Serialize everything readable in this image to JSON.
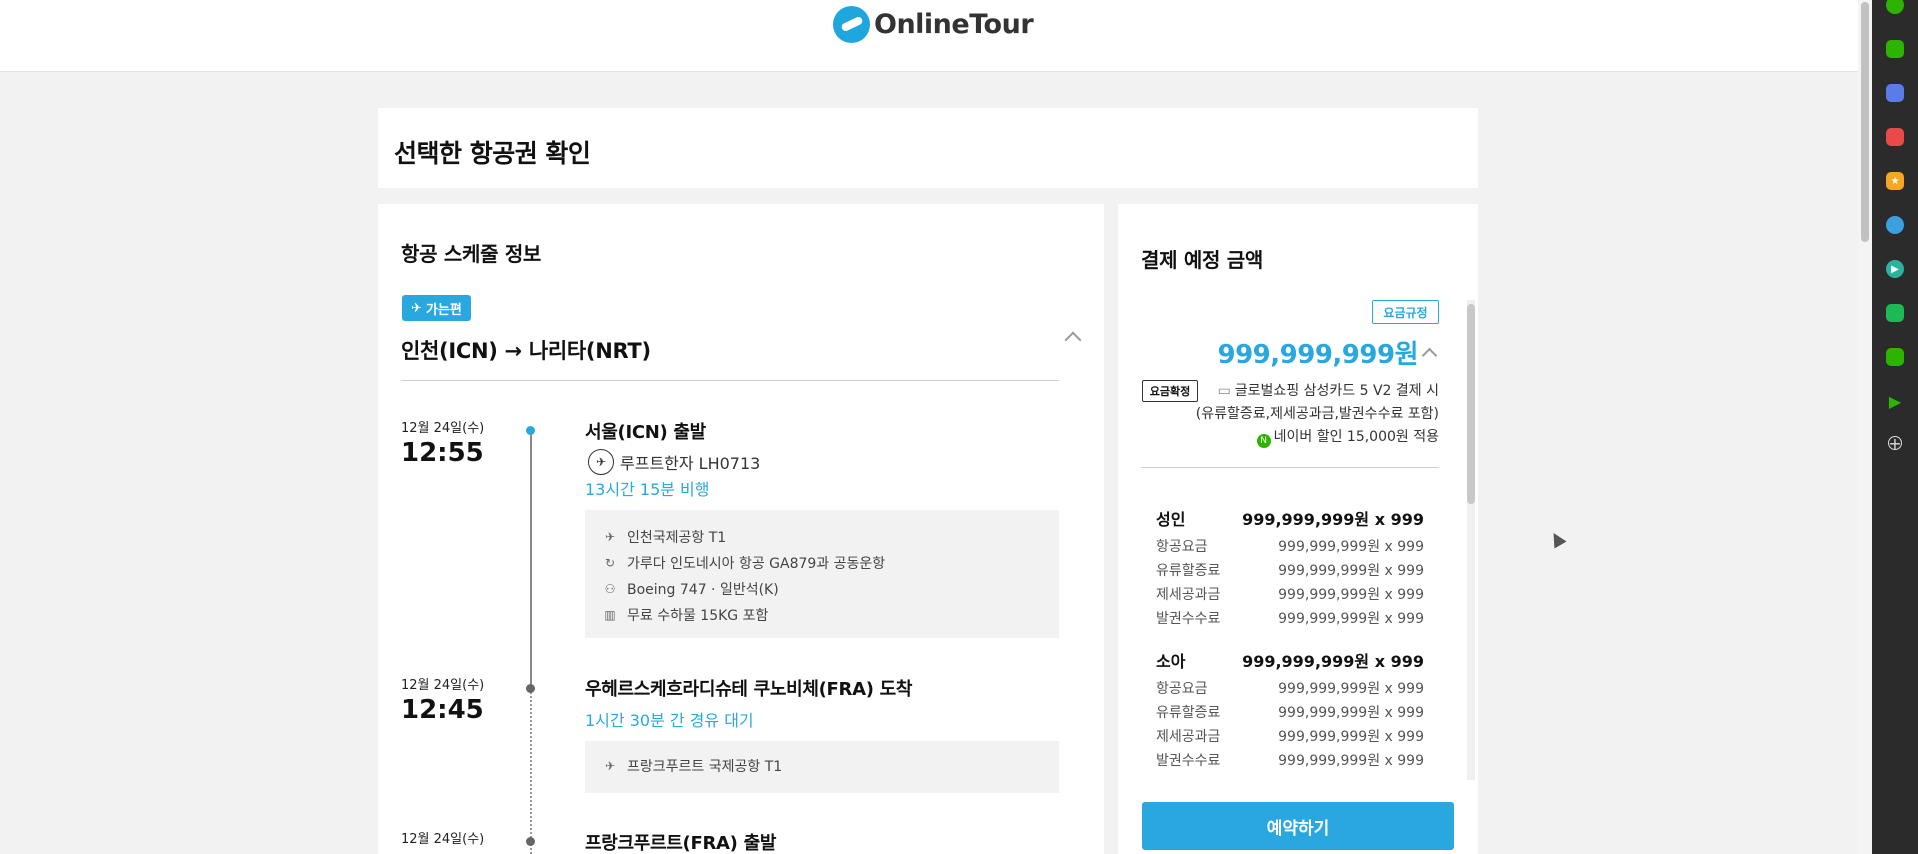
{
  "header": {
    "logo_text": "OnlineTour"
  },
  "page": {
    "title": "선택한 항공권 확인"
  },
  "schedule": {
    "title": "항공 스케줄 정보",
    "direction_badge": "가는편",
    "route": "인천(ICN) → 나리타(NRT)",
    "segments": [
      {
        "date": "12월 24일(수)",
        "time": "12:55",
        "title": "서울(ICN) 출발",
        "airline": "루프트한자 LH0713",
        "accent": "13시간 15분 비행",
        "details": [
          {
            "icon": "airport-icon",
            "text": "인천국제공항 T1"
          },
          {
            "icon": "codeshare-icon",
            "text": "가루다 인도네시아 항공 GA879과 공동운항"
          },
          {
            "icon": "seat-icon",
            "text": "Boeing 747 · 일반석(K)"
          },
          {
            "icon": "baggage-icon",
            "text": "무료 수하물 15KG 포함"
          }
        ]
      },
      {
        "date": "12월 24일(수)",
        "time": "12:45",
        "title": "우헤르스케흐라디슈테 쿠노비체(FRA) 도착",
        "accent": "1시간 30분 간 경유 대기",
        "details": [
          {
            "icon": "airport-icon",
            "text": "프랑크푸르트 국제공항 T1"
          }
        ]
      },
      {
        "date": "12월 24일(수)",
        "title": "프랑크푸르트(FRA) 출발"
      }
    ]
  },
  "payment": {
    "title": "결제 예정 금액",
    "rule_button": "요금규정",
    "total": "999,999,999원",
    "confirm_badge": "요금확정",
    "card_line": "글로벌쇼핑 삼성카드 5 V2 결제 시",
    "includes_line": "(유류할증료,제세공과금,발권수수료 포함)",
    "naver_line": "네이버 할인 15,000원 적용",
    "groups": [
      {
        "label": "성인",
        "value": "999,999,999원 x 999",
        "rows": [
          {
            "label": "항공요금",
            "value": "999,999,999원 x 999"
          },
          {
            "label": "유류할증료",
            "value": "999,999,999원 x 999"
          },
          {
            "label": "제세공과금",
            "value": "999,999,999원 x 999"
          },
          {
            "label": "발권수수료",
            "value": "999,999,999원 x 999"
          }
        ]
      },
      {
        "label": "소아",
        "value": "999,999,999원 x 999",
        "rows": [
          {
            "label": "항공요금",
            "value": "999,999,999원 x 999"
          },
          {
            "label": "유류할증료",
            "value": "999,999,999원 x 999"
          },
          {
            "label": "제세공과금",
            "value": "999,999,999원 x 999"
          },
          {
            "label": "발권수수료",
            "value": "999,999,999원 x 999"
          }
        ]
      }
    ],
    "book_button": "예약하기"
  },
  "colors": {
    "accent": "#29a8e0",
    "naver": "#2db400"
  }
}
